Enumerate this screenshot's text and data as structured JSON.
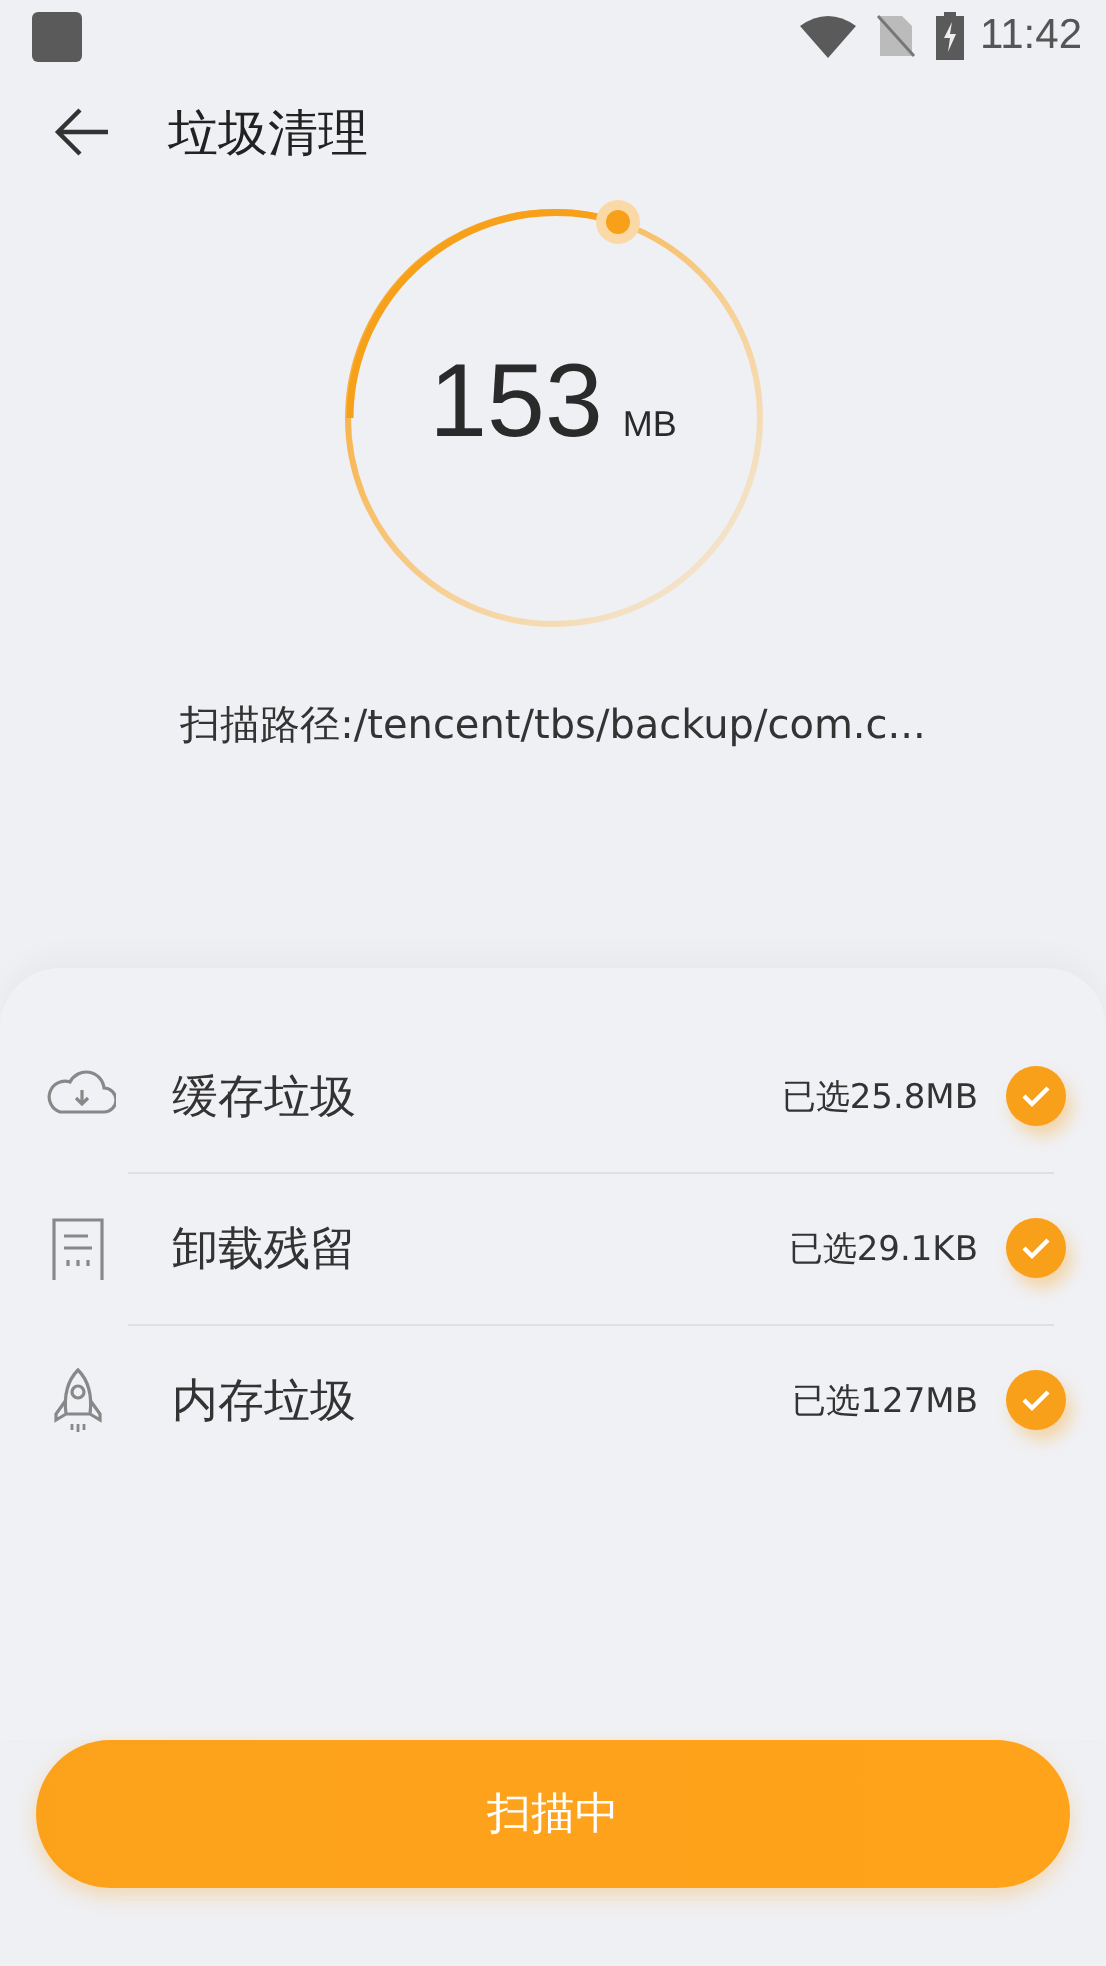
{
  "status_bar": {
    "time": "11:42"
  },
  "header": {
    "title": "垃圾清理"
  },
  "scan": {
    "amount": "153",
    "unit": "MB",
    "path": "扫描路径:/tencent/tbs/backup/com.c..."
  },
  "items": [
    {
      "kind": "cloud",
      "name": "缓存垃圾",
      "selected_size": "已选25.8MB",
      "checked": true
    },
    {
      "kind": "document",
      "name": "卸载残留",
      "selected_size": "已选29.1KB",
      "checked": true
    },
    {
      "kind": "rocket",
      "name": "内存垃圾",
      "selected_size": "已选127MB",
      "checked": true
    }
  ],
  "button": {
    "label": "扫描中"
  }
}
